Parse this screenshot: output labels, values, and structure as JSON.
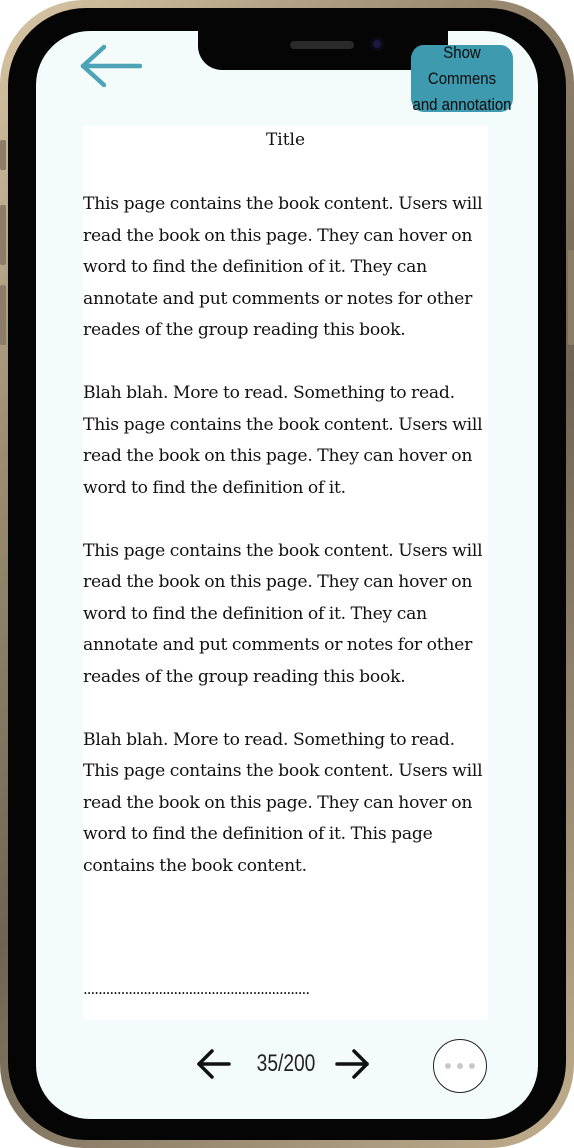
{
  "header": {
    "back_icon": "arrow-left-icon",
    "show_button": {
      "line1": "Show Commens",
      "line2": "and annotation"
    },
    "accent_color": "#3e9aae"
  },
  "book": {
    "title": "Title",
    "paragraphs": [
      "This page contains the book content. Users will read the book on this page. They can hover on word to find the definition of it. They can annotate and put comments or notes for other reades of the group reading this book.",
      "Blah blah. More to read. Something to read. This page contains the book content. Users will read the book on this page. They can hover on word to find the definition of it.",
      "This page contains the book content. Users will read the book on this page. They can hover on word to find the definition of it. They can annotate and put comments or notes for other reades of the group reading this book.",
      "Blah blah. More to read. Something to read. This page contains the book content. Users will read the book on this page. They can hover on word to find the definition of it. This page contains the book content."
    ],
    "continuation": "............................................................"
  },
  "pager": {
    "prev_icon": "arrow-left-icon",
    "next_icon": "arrow-right-icon",
    "page_label": "35/200",
    "more_icon": "ellipsis-icon"
  }
}
